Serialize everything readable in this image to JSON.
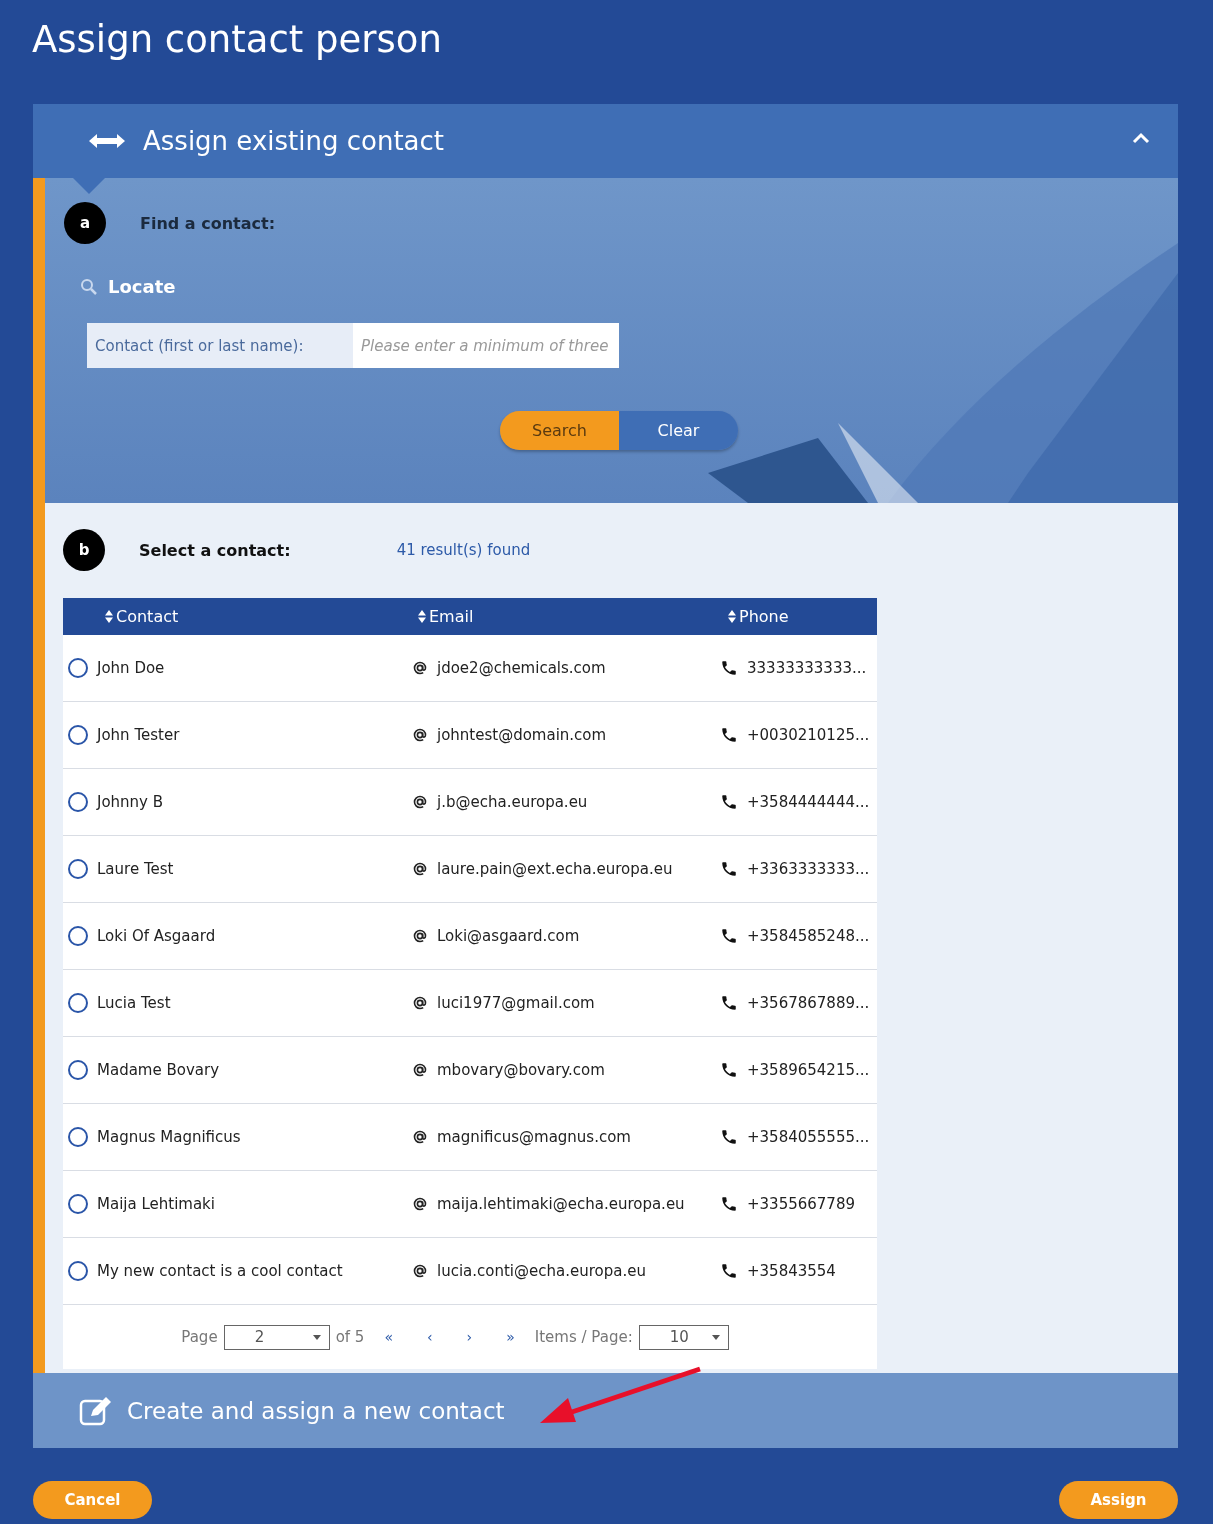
{
  "window": {
    "title": "Assign contact person"
  },
  "assign_existing": {
    "title": "Assign existing contact",
    "expanded": true
  },
  "find": {
    "step": "a",
    "label": "Find a contact:",
    "locate": "Locate",
    "field_label": "Contact (first or last name):",
    "placeholder": "Please enter a minimum of three",
    "buttons": [
      {
        "label": "Search",
        "kind": "primary"
      },
      {
        "label": "Clear",
        "kind": "secondary"
      }
    ]
  },
  "select": {
    "step": "b",
    "label": "Select a contact:",
    "results": "41 result(s) found"
  },
  "table": {
    "columns": [
      "Contact",
      "Email",
      "Phone"
    ],
    "rows": [
      {
        "contact": "John Doe",
        "email": "jdoe2@chemicals.com",
        "phone": "33333333333...",
        "selected": false
      },
      {
        "contact": "John Tester",
        "email": "johntest@domain.com",
        "phone": "+0030210125...",
        "selected": false
      },
      {
        "contact": "Johnny B",
        "email": "j.b@echa.europa.eu",
        "phone": "+3584444444...",
        "selected": false
      },
      {
        "contact": "Laure Test",
        "email": "laure.pain@ext.echa.europa.eu",
        "phone": "+3363333333...",
        "selected": false
      },
      {
        "contact": "Loki Of Asgaard",
        "email": "Loki@asgaard.com",
        "phone": "+3584585248...",
        "selected": false
      },
      {
        "contact": "Lucia Test",
        "email": "luci1977@gmail.com",
        "phone": "+3567867889...",
        "selected": false
      },
      {
        "contact": "Madame Bovary",
        "email": "mbovary@bovary.com",
        "phone": "+3589654215...",
        "selected": false
      },
      {
        "contact": "Magnus Magnificus",
        "email": "magnificus@magnus.com",
        "phone": "+3584055555...",
        "selected": false
      },
      {
        "contact": "Maija Lehtimaki",
        "email": "maija.lehtimaki@echa.europa.eu",
        "phone": "+3355667789",
        "selected": false
      },
      {
        "contact": "My new contact is a cool contact",
        "email": "lucia.conti@echa.europa.eu",
        "phone": "+35843554",
        "selected": false
      }
    ]
  },
  "pager": {
    "page_label": "Page",
    "page": "2",
    "of": "of 5",
    "first": "«",
    "prev": "‹",
    "next": "›",
    "last": "»",
    "items_label": "Items / Page:",
    "items": "10"
  },
  "create": {
    "title": "Create and assign a new contact"
  },
  "footer_buttons": [
    "Cancel",
    "Assign"
  ]
}
